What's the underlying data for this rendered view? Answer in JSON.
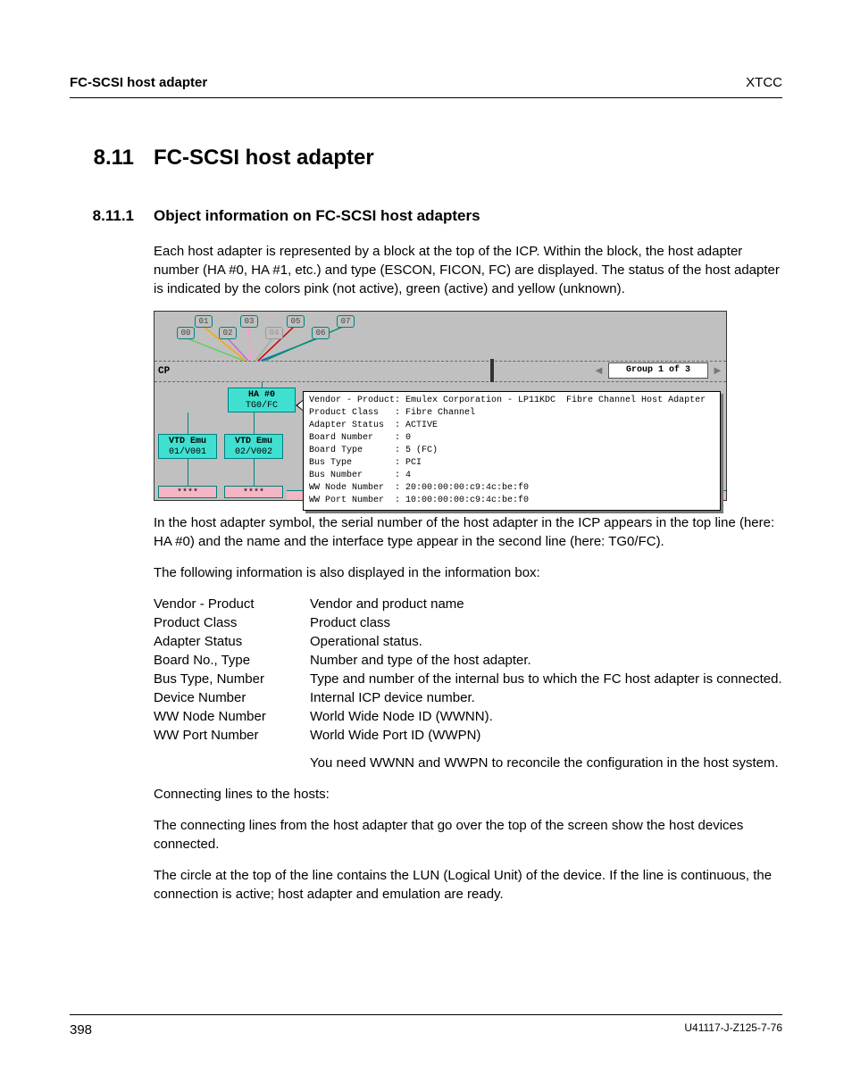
{
  "header": {
    "left": "FC-SCSI host adapter",
    "right": "XTCC"
  },
  "section": {
    "num": "8.11",
    "title": "FC-SCSI host adapter"
  },
  "subsection": {
    "num": "8.11.1",
    "title": "Object information on FC-SCSI host adapters"
  },
  "para1": "Each host adapter is represented by a block at the top of the ICP. Within the block, the host adapter number (HA #0, HA #1, etc.) and type (ESCON, FICON, FC) are displayed. The status of the host adapter is indicated by the colors pink (not active), green (active) and yellow (unknown).",
  "figure": {
    "luns": [
      "00",
      "01",
      "02",
      "03",
      "04",
      "05",
      "06",
      "07"
    ],
    "cp_label": "CP",
    "group_label": "Group 1 of 3",
    "ha": {
      "line1": "HA #0",
      "line2": "TG0/FC"
    },
    "vtd": [
      {
        "line1": "VTD Emu",
        "line2": "01/V001"
      },
      {
        "line1": "VTD Emu",
        "line2": "02/V002"
      }
    ],
    "pink_text": "****",
    "tooltip": "Vendor - Product: Emulex Corporation - LP11KDC  Fibre Channel Host Adapter\nProduct Class   : Fibre Channel\nAdapter Status  : ACTIVE\nBoard Number    : 0\nBoard Type      : 5 (FC)\nBus Type        : PCI\nBus Number      : 4\nWW Node Number  : 20:00:00:00:c9:4c:be:f0\nWW Port Number  : 10:00:00:00:c9:4c:be:f0"
  },
  "para2": "In the host adapter symbol, the serial number of the host adapter in the ICP appears in the top line (here: HA #0) and the name and the interface type appear in the second line (here: TG0/FC).",
  "para3": "The following information is also displayed in the information box:",
  "defs": [
    {
      "term": "Vendor - Product",
      "desc": "Vendor and product name"
    },
    {
      "term": "Product Class",
      "desc": "Product class"
    },
    {
      "term": "Adapter Status",
      "desc": "Operational status."
    },
    {
      "term": "Board No., Type",
      "desc": "Number and type of the host adapter."
    },
    {
      "term": "Bus Type, Number",
      "desc": "Type and number of the internal bus to which the FC host adapter is connected."
    },
    {
      "term": "Device Number",
      "desc": "Internal ICP device number."
    },
    {
      "term": "WW Node Number",
      "desc": "World Wide Node ID (WWNN)."
    },
    {
      "term": "WW Port Number",
      "desc": "World Wide Port ID (WWPN)"
    }
  ],
  "def_extra": "You need WWNN and WWPN to reconcile the configuration in the host system.",
  "para4": "Connecting lines to the hosts:",
  "para5": "The connecting lines from the host adapter that go over the top of the screen show the host devices connected.",
  "para6": "The circle at the top of the line contains the LUN (Logical Unit) of the device. If the line is continuous, the connection is active; host adapter and emulation are ready.",
  "footer": {
    "page": "398",
    "docid": "U41117-J-Z125-7-76"
  }
}
